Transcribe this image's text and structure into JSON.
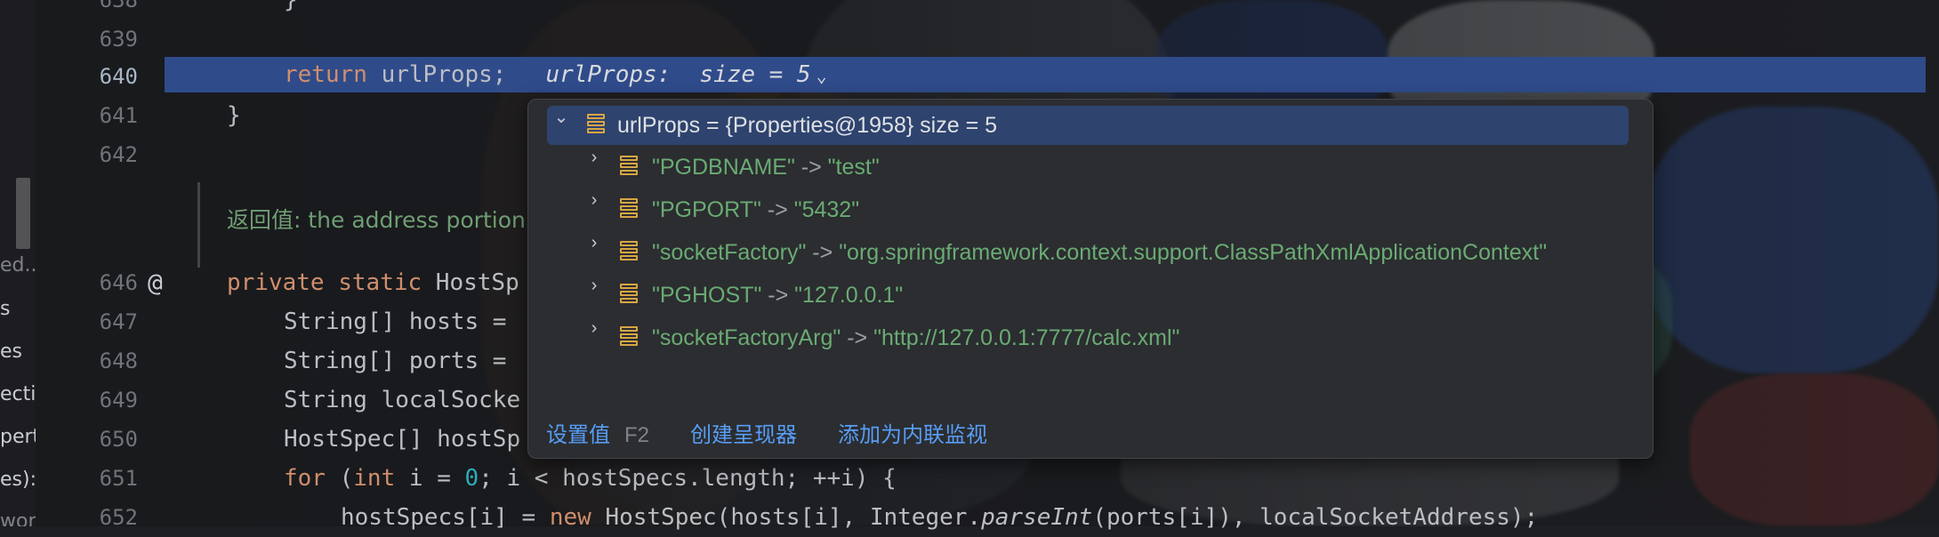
{
  "colors": {
    "editor_bg": "#1e1f22",
    "highlight_line": "#2f4b8a",
    "keyword": "#cf8e6d",
    "number": "#2aacb8",
    "string": "#6aab73",
    "link": "#589df6",
    "popup_bg": "#2b2d30",
    "popup_selected_row": "#2e436e",
    "field_icon": "#d8a544"
  },
  "left_panel": {
    "items": [
      "ed..",
      "s",
      "es",
      "ecti",
      "perti",
      "es):",
      "wor"
    ]
  },
  "gutter": {
    "line_numbers": [
      "638",
      "639",
      "640",
      "641",
      "642",
      "646",
      "647",
      "648",
      "649",
      "650",
      "651",
      "652"
    ],
    "at_icon": "@"
  },
  "code": {
    "l638": "}",
    "l640_kw": "return",
    "l640_rest": " urlProps;",
    "l640_hint_name": "urlProps:",
    "l640_hint_size": "size = 5",
    "l641": "}",
    "doc_comment": "返回值: the address portion",
    "l646_kw1": "private",
    "l646_kw2": "static",
    "l646_rest": " HostSp",
    "l647": "String[] hosts = ",
    "l648": "String[] ports = ",
    "l649": "String localSocke",
    "l650": "HostSpec[] hostSp",
    "l651_kw1": "for",
    "l651_a": " (",
    "l651_kw2": "int",
    "l651_b": " i = ",
    "l651_num": "0",
    "l651_c": "; i < hostSpecs.length; ++i) {",
    "l652_a": "hostSpecs[i] = ",
    "l652_kw": "new",
    "l652_b": " HostSpec(hosts[i], Integer.",
    "l652_it": "parseInt",
    "l652_c": "(ports[i]), localSocketAddress);"
  },
  "popup": {
    "root": "urlProps = {Properties@1958}  size = 5",
    "entries": [
      {
        "key": "\"PGDBNAME\"",
        "arrow": " -> ",
        "value": "\"test\""
      },
      {
        "key": "\"PGPORT\"",
        "arrow": " -> ",
        "value": "\"5432\""
      },
      {
        "key": "\"socketFactory\"",
        "arrow": " -> ",
        "value": "\"org.springframework.context.support.ClassPathXmlApplicationContext\""
      },
      {
        "key": "\"PGHOST\"",
        "arrow": " -> ",
        "value": "\"127.0.0.1\""
      },
      {
        "key": "\"socketFactoryArg\"",
        "arrow": " -> ",
        "value": "\"http://127.0.0.1:7777/calc.xml\""
      }
    ],
    "footer": {
      "set_value": "设置值",
      "set_value_shortcut": "F2",
      "create_renderer": "创建呈现器",
      "add_inline_watch": "添加为内联监视"
    }
  }
}
